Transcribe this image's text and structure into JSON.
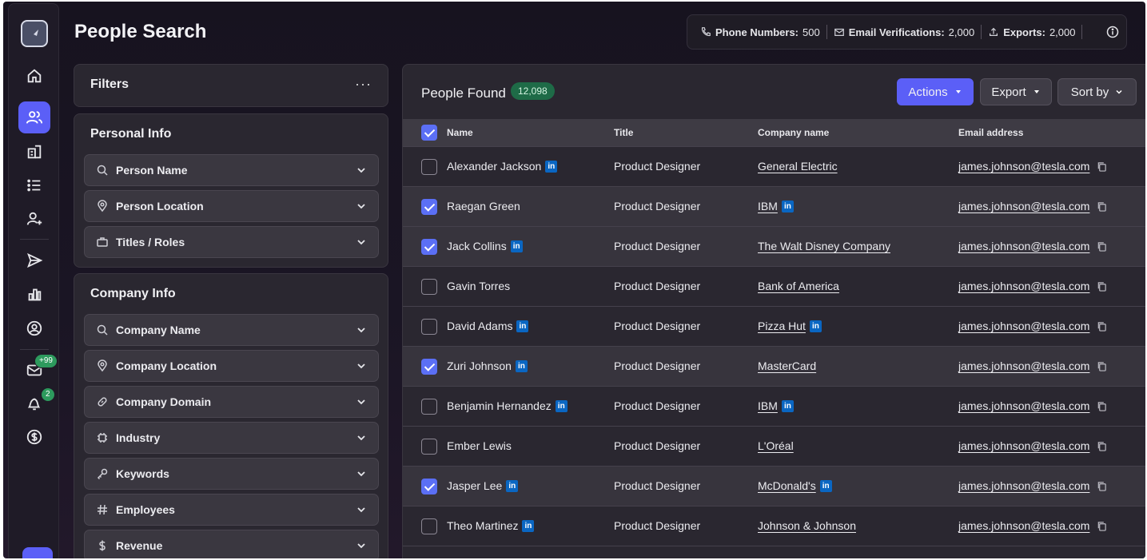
{
  "page_title": "People Search",
  "credits": {
    "phone_label": "Phone Numbers:",
    "phone_value": "500",
    "email_label": "Email Verifications:",
    "email_value": "2,000",
    "exports_label": "Exports:",
    "exports_value": "2,000"
  },
  "sidebar": {
    "icons": [
      "home-icon",
      "people-icon",
      "building-icon",
      "list-icon",
      "add-person-icon",
      "send-icon",
      "chart-icon",
      "account-icon",
      "inbox-icon",
      "bell-icon",
      "dollar-icon"
    ],
    "inbox_badge": "+99",
    "bell_badge": "2"
  },
  "filters": {
    "title": "Filters",
    "more": "···",
    "personal": {
      "title": "Personal Info",
      "items": [
        "Person Name",
        "Person Location",
        "Titles / Roles"
      ]
    },
    "company": {
      "title": "Company Info",
      "items": [
        "Company Name",
        "Company Location",
        "Company Domain",
        "Industry",
        "Keywords",
        "Employees",
        "Revenue"
      ]
    }
  },
  "results": {
    "title": "People Found",
    "count": "12,098",
    "actions_label": "Actions",
    "export_label": "Export",
    "sort_label": "Sort by",
    "columns": [
      "Name",
      "Title",
      "Company name",
      "Email address"
    ],
    "rows": [
      {
        "name": "Alexander Jackson",
        "title": "Product Designer",
        "company": "General Electric",
        "email": "james.johnson@tesla.com"
      },
      {
        "name": "Raegan Green",
        "title": "Product Designer",
        "company": "IBM",
        "email": "james.johnson@tesla.com"
      },
      {
        "name": "Jack Collins",
        "title": "Product Designer",
        "company": "The Walt Disney Company",
        "email": "james.johnson@tesla.com"
      },
      {
        "name": "Gavin Torres",
        "title": "Product Designer",
        "company": "Bank of America",
        "email": "james.johnson@tesla.com"
      },
      {
        "name": "David Adams",
        "title": "Product Designer",
        "company": "Pizza Hut",
        "email": "james.johnson@tesla.com"
      },
      {
        "name": "Zuri Johnson",
        "title": "Product Designer",
        "company": "MasterCard",
        "email": "james.johnson@tesla.com"
      },
      {
        "name": "Benjamin Hernandez",
        "title": "Product Designer",
        "company": "IBM",
        "email": "james.johnson@tesla.com"
      },
      {
        "name": "Ember Lewis",
        "title": "Product Designer",
        "company": "L'Oréal",
        "email": "james.johnson@tesla.com"
      },
      {
        "name": "Jasper Lee",
        "title": "Product Designer",
        "company": "McDonald's",
        "email": "james.johnson@tesla.com"
      },
      {
        "name": "Theo Martinez",
        "title": "Product Designer",
        "company": "Johnson & Johnson",
        "email": "james.johnson@tesla.com"
      }
    ],
    "linkedin_label": "in"
  },
  "colors": {
    "accent": "#5b5ff7",
    "linkedin": "#0a66c2",
    "count_green": "#1e6b47"
  }
}
